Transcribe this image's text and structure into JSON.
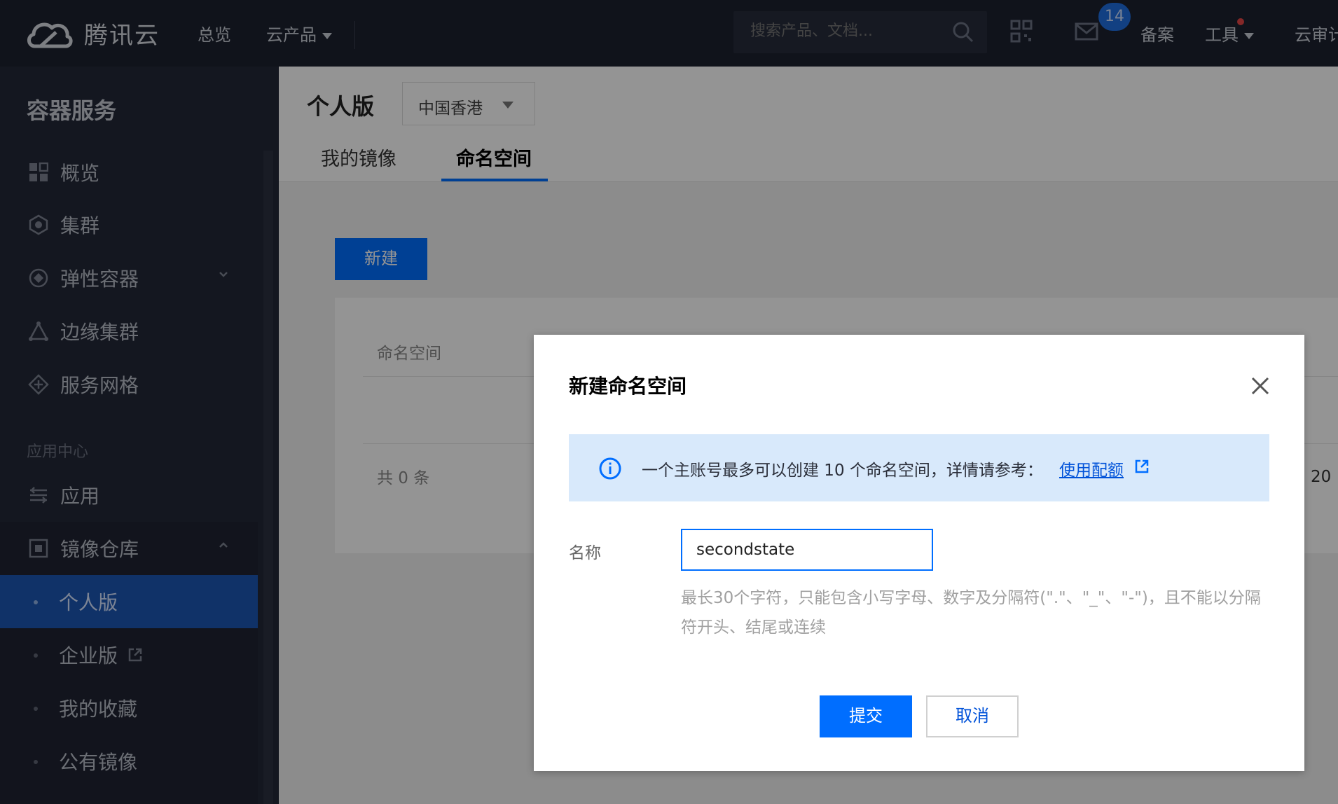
{
  "topbar": {
    "logo_text": "腾讯云",
    "nav": [
      "总览",
      "云产品"
    ],
    "search_placeholder": "搜索产品、文档...",
    "mail_badge": "14",
    "links": [
      "备案",
      "工具",
      "云审计"
    ]
  },
  "sidebar": {
    "title": "容器服务",
    "items": [
      "概览",
      "集群",
      "弹性容器",
      "边缘集群",
      "服务网格"
    ],
    "section_label": "应用中心",
    "app_item": "应用",
    "registry_item": "镜像仓库",
    "registry_sub": [
      "个人版",
      "企业版",
      "我的收藏",
      "公有镜像"
    ]
  },
  "main": {
    "title": "个人版",
    "region": "中国香港",
    "tabs": [
      "我的镜像",
      "命名空间"
    ],
    "new_button": "新建",
    "column_namespace": "命名空间",
    "total": "共  0  条",
    "page_size": "20"
  },
  "dialog": {
    "title": "新建命名空间",
    "notice_text": "一个主账号最多可以创建 10 个命名空间，详情请参考：",
    "notice_link": "使用配额",
    "field_label": "名称",
    "field_value": "secondstate",
    "hint": "最长30个字符，只能包含小写字母、数字及分隔符(\".\"、\"_\"、\"-\")，且不能以分隔符开头、结尾或连续",
    "submit": "提交",
    "cancel": "取消"
  },
  "colors": {
    "primary": "#006eff",
    "topbar_bg": "#1c2130",
    "sidebar_bg": "#232938",
    "active_item": "#1d57b4",
    "notice_bg": "#d8e9fb"
  }
}
